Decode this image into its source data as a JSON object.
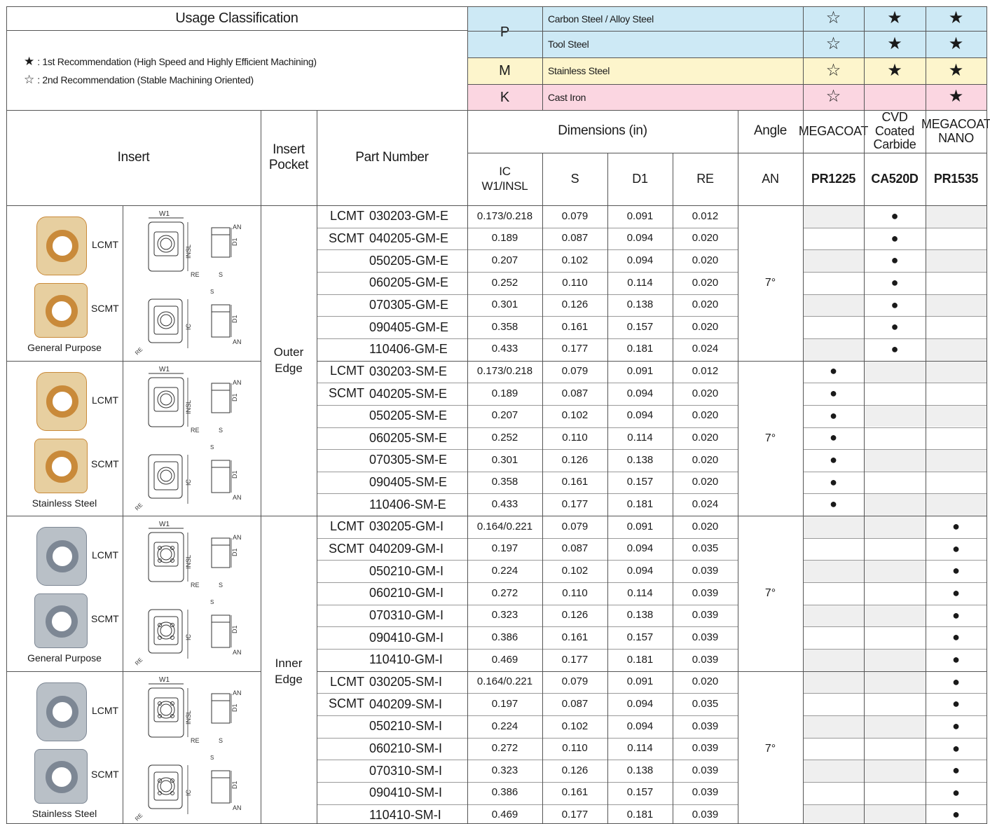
{
  "header": {
    "usage_title": "Usage Classification",
    "legend": [
      {
        "symbol": "★",
        "text": ": 1st Recommendation (High Speed and Highly Efficient Machining)"
      },
      {
        "symbol": "☆",
        "text": ": 2nd Recommendation (Stable Machining Oriented)"
      }
    ],
    "iso_groups": [
      {
        "code": "P",
        "color": "#cde9f5",
        "rows": [
          {
            "material": "Carbon Steel / Alloy Steel",
            "marks": [
              "☆",
              "★",
              "★"
            ]
          },
          {
            "material": "Tool Steel",
            "marks": [
              "☆",
              "★",
              "★"
            ]
          }
        ]
      },
      {
        "code": "M",
        "color": "#fdf5cc",
        "rows": [
          {
            "material": "Stainless Steel",
            "marks": [
              "☆",
              "★",
              "★"
            ]
          }
        ]
      },
      {
        "code": "K",
        "color": "#fbd6e1",
        "rows": [
          {
            "material": "Cast Iron",
            "marks": [
              "☆",
              "",
              "★"
            ]
          }
        ]
      }
    ]
  },
  "columns": {
    "insert": "Insert",
    "insert_pocket": "Insert Pocket",
    "part_number": "Part Number",
    "dimensions": "Dimensions (in)",
    "angle": "Angle",
    "ic": "IC",
    "w1insl": "W1/INSL",
    "s": "S",
    "d1": "D1",
    "re": "RE",
    "an": "AN",
    "grades": [
      {
        "type": "MEGACOAT",
        "code": "PR1225"
      },
      {
        "type": "CVD Coated Carbide",
        "code": "CA520D"
      },
      {
        "type": "MEGACOAT NANO",
        "code": "PR1535"
      }
    ]
  },
  "pockets": [
    "Outer Edge",
    "Inner Edge"
  ],
  "groups": [
    {
      "type_label": "General Purpose",
      "lcmt": "LCMT",
      "scmt": "SCMT",
      "angle": "7°",
      "grade_col": 1,
      "tone": "gold",
      "rows": [
        {
          "series": "LCMT",
          "part": "030203-GM-E",
          "ic": "0.173/0.218",
          "s": "0.079",
          "d1": "0.091",
          "re": "0.012"
        },
        {
          "series": "SCMT",
          "part": "040205-GM-E",
          "ic": "0.189",
          "s": "0.087",
          "d1": "0.094",
          "re": "0.020"
        },
        {
          "series": "",
          "part": "050205-GM-E",
          "ic": "0.207",
          "s": "0.102",
          "d1": "0.094",
          "re": "0.020"
        },
        {
          "series": "",
          "part": "060205-GM-E",
          "ic": "0.252",
          "s": "0.110",
          "d1": "0.114",
          "re": "0.020"
        },
        {
          "series": "",
          "part": "070305-GM-E",
          "ic": "0.301",
          "s": "0.126",
          "d1": "0.138",
          "re": "0.020"
        },
        {
          "series": "",
          "part": "090405-GM-E",
          "ic": "0.358",
          "s": "0.161",
          "d1": "0.157",
          "re": "0.020"
        },
        {
          "series": "",
          "part": "110406-GM-E",
          "ic": "0.433",
          "s": "0.177",
          "d1": "0.181",
          "re": "0.024"
        }
      ]
    },
    {
      "type_label": "Stainless Steel",
      "lcmt": "LCMT",
      "scmt": "SCMT",
      "angle": "7°",
      "grade_col": 0,
      "tone": "gold",
      "rows": [
        {
          "series": "LCMT",
          "part": "030203-SM-E",
          "ic": "0.173/0.218",
          "s": "0.079",
          "d1": "0.091",
          "re": "0.012"
        },
        {
          "series": "SCMT",
          "part": "040205-SM-E",
          "ic": "0.189",
          "s": "0.087",
          "d1": "0.094",
          "re": "0.020"
        },
        {
          "series": "",
          "part": "050205-SM-E",
          "ic": "0.207",
          "s": "0.102",
          "d1": "0.094",
          "re": "0.020"
        },
        {
          "series": "",
          "part": "060205-SM-E",
          "ic": "0.252",
          "s": "0.110",
          "d1": "0.114",
          "re": "0.020"
        },
        {
          "series": "",
          "part": "070305-SM-E",
          "ic": "0.301",
          "s": "0.126",
          "d1": "0.138",
          "re": "0.020"
        },
        {
          "series": "",
          "part": "090405-SM-E",
          "ic": "0.358",
          "s": "0.161",
          "d1": "0.157",
          "re": "0.020"
        },
        {
          "series": "",
          "part": "110406-SM-E",
          "ic": "0.433",
          "s": "0.177",
          "d1": "0.181",
          "re": "0.024"
        }
      ]
    },
    {
      "type_label": "General Purpose",
      "lcmt": "LCMT",
      "scmt": "SCMT",
      "angle": "7°",
      "grade_col": 2,
      "tone": "silver",
      "rows": [
        {
          "series": "LCMT",
          "part": "030205-GM-I",
          "ic": "0.164/0.221",
          "s": "0.079",
          "d1": "0.091",
          "re": "0.020"
        },
        {
          "series": "SCMT",
          "part": "040209-GM-I",
          "ic": "0.197",
          "s": "0.087",
          "d1": "0.094",
          "re": "0.035"
        },
        {
          "series": "",
          "part": "050210-GM-I",
          "ic": "0.224",
          "s": "0.102",
          "d1": "0.094",
          "re": "0.039"
        },
        {
          "series": "",
          "part": "060210-GM-I",
          "ic": "0.272",
          "s": "0.110",
          "d1": "0.114",
          "re": "0.039"
        },
        {
          "series": "",
          "part": "070310-GM-I",
          "ic": "0.323",
          "s": "0.126",
          "d1": "0.138",
          "re": "0.039"
        },
        {
          "series": "",
          "part": "090410-GM-I",
          "ic": "0.386",
          "s": "0.161",
          "d1": "0.157",
          "re": "0.039"
        },
        {
          "series": "",
          "part": "110410-GM-I",
          "ic": "0.469",
          "s": "0.177",
          "d1": "0.181",
          "re": "0.039"
        }
      ]
    },
    {
      "type_label": "Stainless Steel",
      "lcmt": "LCMT",
      "scmt": "SCMT",
      "angle": "7°",
      "grade_col": 2,
      "tone": "silver",
      "rows": [
        {
          "series": "LCMT",
          "part": "030205-SM-I",
          "ic": "0.164/0.221",
          "s": "0.079",
          "d1": "0.091",
          "re": "0.020"
        },
        {
          "series": "SCMT",
          "part": "040209-SM-I",
          "ic": "0.197",
          "s": "0.087",
          "d1": "0.094",
          "re": "0.035"
        },
        {
          "series": "",
          "part": "050210-SM-I",
          "ic": "0.224",
          "s": "0.102",
          "d1": "0.094",
          "re": "0.039"
        },
        {
          "series": "",
          "part": "060210-SM-I",
          "ic": "0.272",
          "s": "0.110",
          "d1": "0.114",
          "re": "0.039"
        },
        {
          "series": "",
          "part": "070310-SM-I",
          "ic": "0.323",
          "s": "0.126",
          "d1": "0.138",
          "re": "0.039"
        },
        {
          "series": "",
          "part": "090410-SM-I",
          "ic": "0.386",
          "s": "0.161",
          "d1": "0.157",
          "re": "0.039"
        },
        {
          "series": "",
          "part": "110410-SM-I",
          "ic": "0.469",
          "s": "0.177",
          "d1": "0.181",
          "re": "0.039"
        }
      ]
    }
  ],
  "marks": {
    "dot": "●"
  },
  "diagram_labels": {
    "w1": "W1",
    "an": "AN",
    "insl": "INSL",
    "d1": "D1",
    "re": "RE",
    "s": "S",
    "ic": "IC"
  }
}
